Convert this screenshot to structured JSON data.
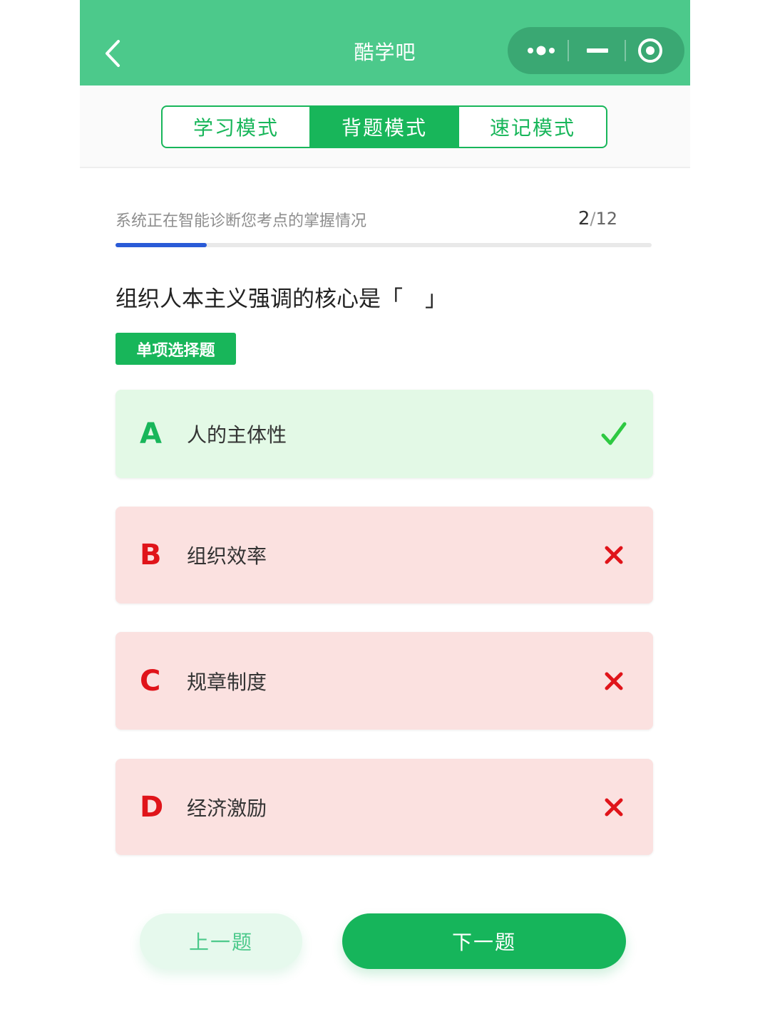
{
  "header": {
    "title": "酷学吧",
    "back_icon": "chevron-left-icon",
    "capsule_icons": [
      "more-dots-icon",
      "minimize-icon",
      "close-circle-icon"
    ]
  },
  "tabs": [
    {
      "label": "学习模式",
      "active": false
    },
    {
      "label": "背题模式",
      "active": true
    },
    {
      "label": "速记模式",
      "active": false
    }
  ],
  "progress": {
    "text": "系统正在智能诊断您考点的掌握情况",
    "current": "2",
    "total": "12",
    "fraction": 0.17
  },
  "question": {
    "text": "组织人本主义强调的核心是「　」",
    "type_label": "单项选择题"
  },
  "options": [
    {
      "letter": "A",
      "text": "人的主体性",
      "status": "correct",
      "icon": "check-icon"
    },
    {
      "letter": "B",
      "text": "组织效率",
      "status": "wrong",
      "icon": "cross-icon"
    },
    {
      "letter": "C",
      "text": "规章制度",
      "status": "wrong",
      "icon": "cross-icon"
    },
    {
      "letter": "D",
      "text": "经济激励",
      "status": "wrong",
      "icon": "cross-icon"
    }
  ],
  "nav": {
    "prev_label": "上一题",
    "next_label": "下一题"
  },
  "colors": {
    "header_green": "#4cc98b",
    "accent_green": "#18b65a",
    "error_red": "#e0141a",
    "progress_blue": "#2a5bd7"
  }
}
